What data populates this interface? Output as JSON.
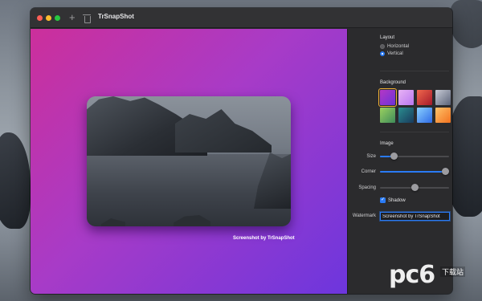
{
  "window": {
    "title": "TrSnapShot"
  },
  "toolbar": {
    "add_icon": "plus-icon",
    "trash_icon": "trash-icon"
  },
  "canvas": {
    "gradient_colors": [
      "#cc2f9b",
      "#6d36dd"
    ],
    "watermark": "Screenshot by TrSnapShot"
  },
  "panel": {
    "layout": {
      "title": "Layout",
      "options": [
        {
          "label": "Horizontal",
          "selected": false
        },
        {
          "label": "Vertical",
          "selected": true
        }
      ]
    },
    "background": {
      "title": "Background",
      "swatches": [
        {
          "name": "purple-gradient",
          "selected": true
        },
        {
          "name": "lavender-gradient",
          "selected": false
        },
        {
          "name": "red-gradient",
          "selected": false
        },
        {
          "name": "grey-gradient",
          "selected": false
        },
        {
          "name": "green-gradient",
          "selected": false
        },
        {
          "name": "teal-gradient",
          "selected": false
        },
        {
          "name": "blue-gradient",
          "selected": false
        },
        {
          "name": "orange-gradient",
          "selected": false
        }
      ]
    },
    "image": {
      "title": "Image",
      "size": {
        "label": "Size",
        "value": 0.2
      },
      "corner": {
        "label": "Corner",
        "value": 0.95
      },
      "spacing": {
        "label": "Spacing",
        "value": 0.5
      },
      "shadow": {
        "label": "Shadow",
        "checked": true
      },
      "watermark": {
        "label": "Watermark",
        "value": "Screenshot by TrSnapShot"
      }
    }
  },
  "site_logo": {
    "text": "pc6",
    "sub": "下载站"
  }
}
